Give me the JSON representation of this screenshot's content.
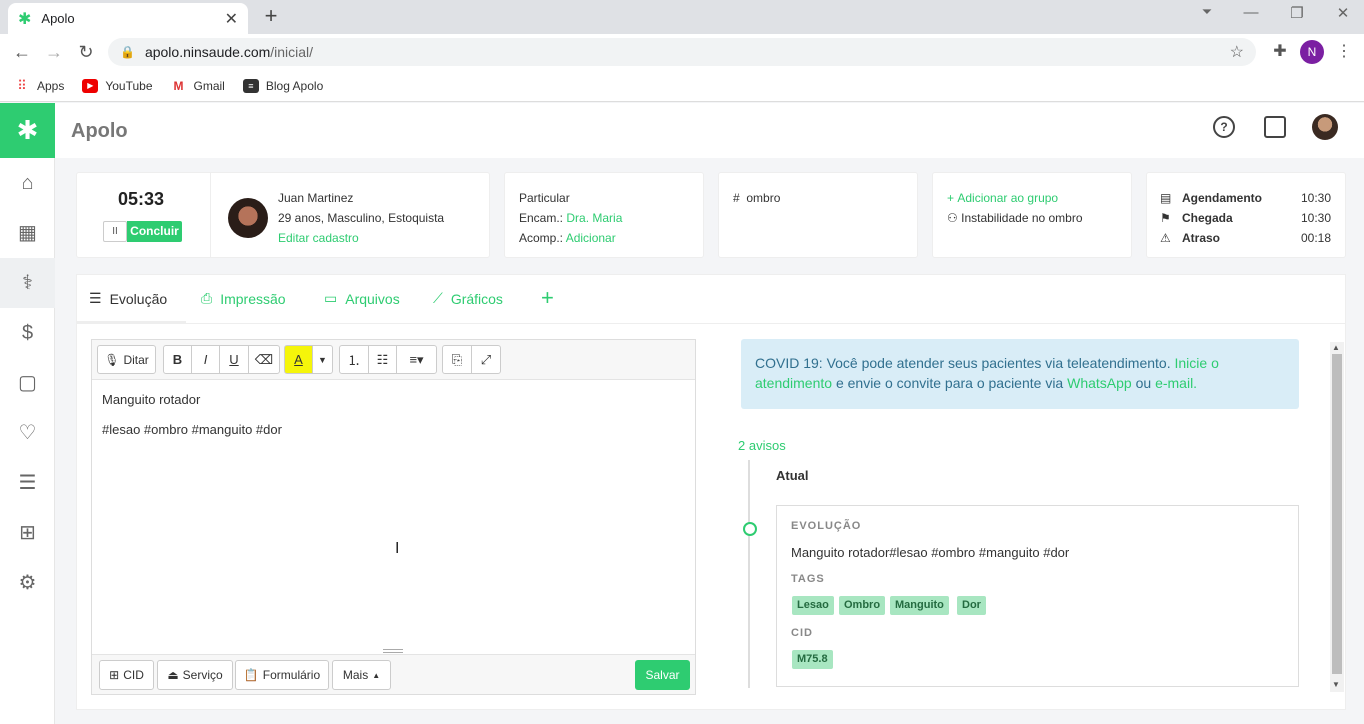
{
  "browser": {
    "tab_title": "Apolo",
    "url_domain": "apolo.ninsaude.com",
    "url_path": "/inicial/",
    "profile_initial": "N",
    "bookmarks": [
      "Apps",
      "YouTube",
      "Gmail",
      "Blog Apolo"
    ]
  },
  "app": {
    "name": "Apolo"
  },
  "session": {
    "timer": "05:33",
    "conclude_label": "Concluir",
    "pause_symbol": "II"
  },
  "patient": {
    "name": "Juan Martinez",
    "details": "29 anos, Masculino, Estoquista",
    "edit_link": "Editar cadastro"
  },
  "insurance": {
    "type": "Particular",
    "encam_label": "Encam.:",
    "encam_value": "Dra. Maria",
    "acomp_label": "Acomp.:",
    "acomp_value": "Adicionar"
  },
  "tags_card": {
    "hash_symbol": "#",
    "tag": "ombro"
  },
  "group_card": {
    "add_label": "Adicionar ao grupo",
    "group_name": "Instabilidade no ombro"
  },
  "schedule": {
    "rows": [
      {
        "label": "Agendamento",
        "time": "10:30"
      },
      {
        "label": "Chegada",
        "time": "10:30"
      },
      {
        "label": "Atraso",
        "time": "00:18"
      }
    ]
  },
  "tabs": [
    {
      "label": "Evolução",
      "active": true
    },
    {
      "label": "Impressão"
    },
    {
      "label": "Arquivos"
    },
    {
      "label": "Gráficos"
    }
  ],
  "editor": {
    "dictate_label": "Ditar",
    "line1": "Manguito rotador",
    "line2": "#lesao #ombro #manguito #dor",
    "bottom_buttons": [
      "CID",
      "Serviço",
      "Formulário",
      "Mais"
    ],
    "save_label": "Salvar"
  },
  "covid": {
    "text1": "COVID 19: Você pode atender seus pacientes via teleatendimento.",
    "link1": "Inicie o atendimento",
    "text2": "e envie o convite para o paciente via",
    "link2": "WhatsApp",
    "text3": "ou",
    "link3": "e-mail."
  },
  "timeline": {
    "warnings": "2 avisos",
    "current_label": "Atual",
    "entry_heading": "EVOLUÇÃO",
    "entry_text": "Manguito rotador#lesao #ombro #manguito #dor",
    "tags_heading": "TAGS",
    "tags": [
      "Lesao",
      "Ombro",
      "Manguito",
      "Dor"
    ],
    "cid_heading": "CID",
    "cid": "M75.8"
  },
  "colors": {
    "brand": "#2ecc71",
    "info_bg": "#d9edf7",
    "tag_bg": "#a8e6c1"
  }
}
